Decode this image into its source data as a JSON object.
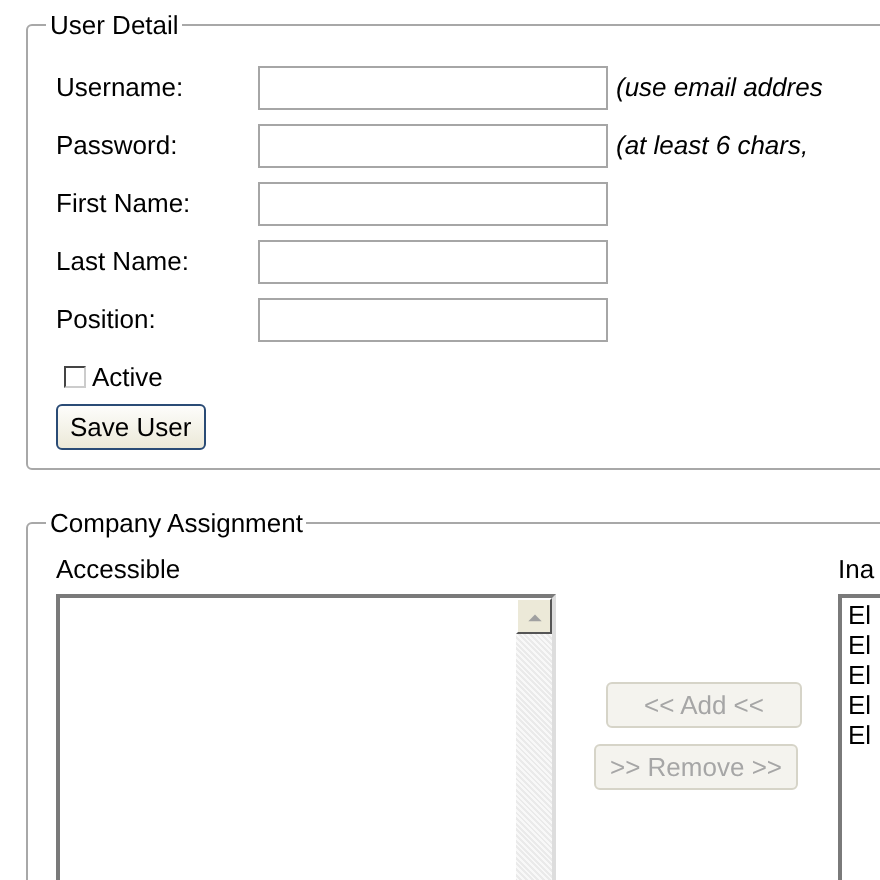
{
  "user_detail": {
    "legend": "User Detail",
    "fields": [
      {
        "label": "Username:",
        "hint": "(use email addres"
      },
      {
        "label": "Password:",
        "hint": "(at least 6 chars,"
      },
      {
        "label": "First Name:"
      },
      {
        "label": "Last Name:"
      },
      {
        "label": "Position:"
      }
    ],
    "active": {
      "label": "Active",
      "checked": false
    },
    "save_button": "Save User"
  },
  "company_assignment": {
    "legend": "Company Assignment",
    "accessible": {
      "label": "Accessible"
    },
    "add_button": {
      "label": "<< Add <<",
      "disabled": true
    },
    "remove_button": {
      "label": ">> Remove >>",
      "disabled": true
    },
    "inactive": {
      "label": "Ina",
      "items": [
        "El",
        "El",
        "El",
        "El",
        "El"
      ]
    }
  }
}
